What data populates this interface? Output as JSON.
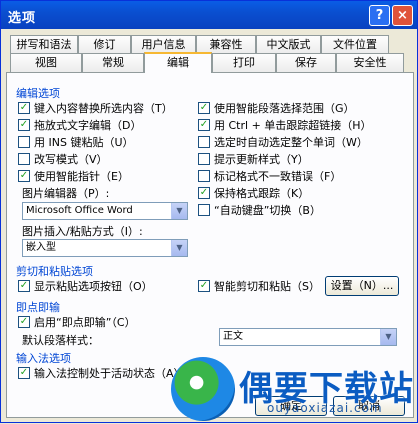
{
  "window": {
    "title": "选项",
    "help_glyph": "?",
    "close_glyph": "×"
  },
  "tabs": {
    "row1": [
      "拼写和语法",
      "修订",
      "用户信息",
      "兼容性",
      "中文版式",
      "文件位置"
    ],
    "row2": [
      "视图",
      "常规",
      "编辑",
      "打印",
      "保存",
      "安全性"
    ],
    "active": "编辑"
  },
  "editing": {
    "title": "编辑选项",
    "left": [
      {
        "label": "键入内容替换所选内容（T）",
        "checked": true
      },
      {
        "label": "拖放式文字编辑（D）",
        "checked": true
      },
      {
        "label": "用 INS 键粘贴（U）",
        "checked": false
      },
      {
        "label": "改写模式（V）",
        "checked": false
      },
      {
        "label": "使用智能指针（E）",
        "checked": true
      }
    ],
    "right": [
      {
        "label": "使用智能段落选择范围（G）",
        "checked": true
      },
      {
        "label": "用 Ctrl + 单击跟踪超链接（H）",
        "checked": true
      },
      {
        "label": "选定时自动选定整个单词（W）",
        "checked": false
      },
      {
        "label": "提示更新样式（Y）",
        "checked": false
      },
      {
        "label": "标记格式不一致错误（F）",
        "checked": false
      },
      {
        "label": "保持格式跟踪（K）",
        "checked": true
      },
      {
        "label": "“自动键盘”切换（B）",
        "checked": false
      }
    ],
    "picture_editor_label": "图片编辑器（P）:",
    "picture_editor_value": "Microsoft Office Word",
    "insert_paste_label": "图片插入/粘贴方式（I）:",
    "insert_paste_value": "嵌入型"
  },
  "cut_paste": {
    "title": "剪切和粘贴选项",
    "show_paste_buttons": {
      "label": "显示粘贴选项按钮（O）",
      "checked": true
    },
    "smart_cut_paste": {
      "label": "智能剪切和粘贴（S）",
      "checked": true
    },
    "settings_button": "设置（N）..."
  },
  "click_type": {
    "title": "即点即输",
    "enable": {
      "label": "启用“即点即输”（C）",
      "checked": true
    },
    "default_style_label": "默认段落样式：",
    "default_style_value": "正文"
  },
  "ime": {
    "title": "输入法选项",
    "ime_active": {
      "label": "输入法控制处于活动状态（A）",
      "checked": true
    }
  },
  "buttons": {
    "ok": "确定",
    "cancel": "取消"
  },
  "watermark": {
    "text": "偶要下载站",
    "url": "ouyaoxiazai.com"
  },
  "colors": {
    "titlebar": "#0a5de6",
    "group_title": "#0046d5",
    "check": "#21a121"
  }
}
